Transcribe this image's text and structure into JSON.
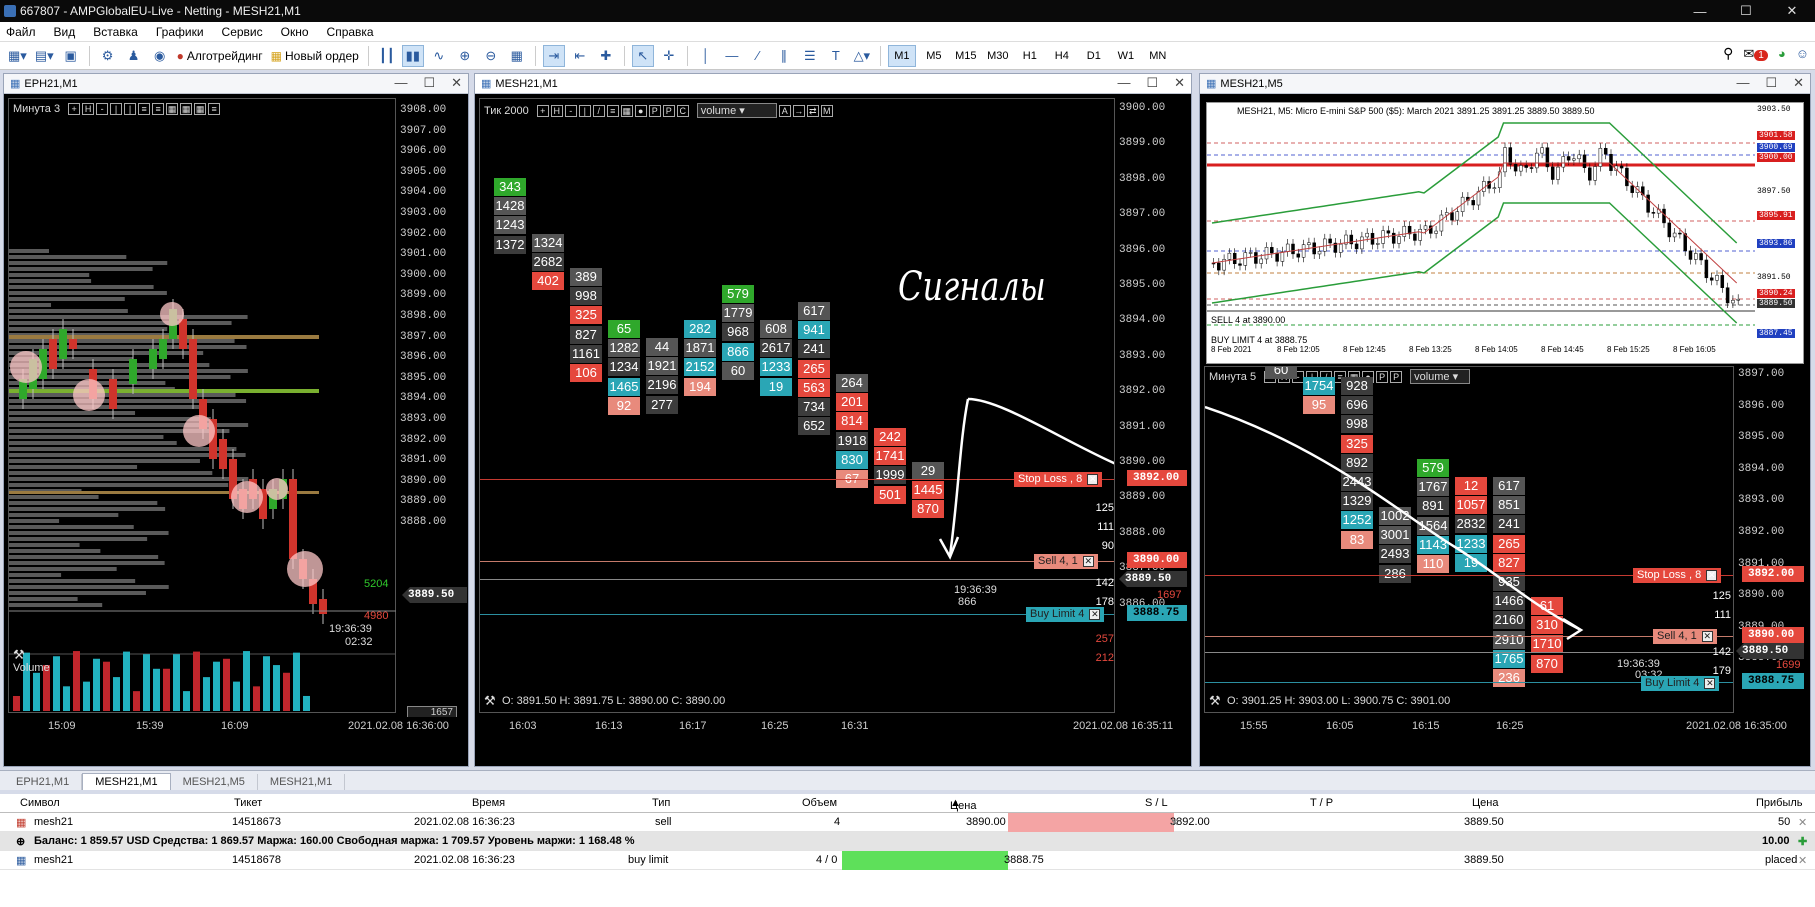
{
  "title": "667807 - AMPGlobalEU-Live - Netting - MESH21,M1",
  "menu": [
    "Файл",
    "Вид",
    "Вставка",
    "Графики",
    "Сервис",
    "Окно",
    "Справка"
  ],
  "toolbar": {
    "algo": "Алготрейдинг",
    "new_order": "Новый ордер",
    "timeframes": [
      "M1",
      "M5",
      "M15",
      "M30",
      "H1",
      "H4",
      "D1",
      "W1",
      "MN"
    ],
    "selected_tf": "M1",
    "notif": "1"
  },
  "w1": {
    "title": "EPH21,M1",
    "ctrl_label": "Минута  3",
    "prices": [
      "3908.00",
      "3907.00",
      "3906.00",
      "3905.00",
      "3904.00",
      "3903.00",
      "3902.00",
      "3901.00",
      "3900.00",
      "3899.00",
      "3898.00",
      "3897.00",
      "3896.00",
      "3895.00",
      "3894.00",
      "3893.00",
      "3892.00",
      "3891.00",
      "3890.00",
      "3889.00",
      "3888.00"
    ],
    "ask_vol": "5204",
    "bid_vol": "4980",
    "cur_price": "3889.50",
    "time": "19:36:39",
    "countdown": "02:32",
    "volume_label": "Volume",
    "volume_value": "1657",
    "times": [
      "15:09",
      "15:39",
      "16:09"
    ],
    "date": "2021.02.08 16:36:00"
  },
  "w2": {
    "title": "MESH21,M1",
    "ctrl_label": "Тик  2000",
    "select_value": "volume",
    "prices": [
      "3900.00",
      "3899.00",
      "3898.00",
      "3897.00",
      "3896.00",
      "3895.00",
      "3894.00",
      "3893.00",
      "3892.00",
      "3891.00",
      "3890.00",
      "3889.00",
      "3888.00",
      "3887.00",
      "3886.00"
    ],
    "sl_label": "Stop Loss , 8",
    "sl_price": "3892.00",
    "sell_label": "Sell  4, 1",
    "sell_price": "3890.00",
    "buy_label": "Buy Limit  4",
    "buy_price": "3888.75",
    "cur_price": "3889.50",
    "red_val": "1697",
    "time": "19:36:39",
    "tick": "866",
    "ohlc": "O: 3891.50   H: 3891.75   L: 3890.00   C: 3890.00",
    "times": [
      "16:03",
      "16:13",
      "16:17",
      "16:25",
      "16:31"
    ],
    "date": "2021.02.08 16:35:11",
    "side_vals": [
      "125",
      "111",
      "90",
      "142",
      "178",
      "257",
      "212"
    ],
    "signal": "Сигналы",
    "cells": [
      {
        "v": "343",
        "c": "c-grn"
      },
      {
        "v": "1428",
        "c": "c-gry"
      },
      {
        "v": "1243",
        "c": "c-gry"
      },
      {
        "v": "1372",
        "c": "c-dgy"
      },
      {
        "v": "1324",
        "c": "c-gry"
      },
      {
        "v": "2682",
        "c": "c-dgy"
      },
      {
        "v": "402",
        "c": "c-red"
      },
      {
        "v": "389",
        "c": "c-gry"
      },
      {
        "v": "998",
        "c": "c-dgy"
      },
      {
        "v": "325",
        "c": "c-red"
      },
      {
        "v": "827",
        "c": "c-dgy"
      },
      {
        "v": "1161",
        "c": "c-dgy"
      },
      {
        "v": "106",
        "c": "c-red"
      },
      {
        "v": "65",
        "c": "c-grn"
      },
      {
        "v": "1282",
        "c": "c-gry"
      },
      {
        "v": "1234",
        "c": "c-dgy"
      },
      {
        "v": "1465",
        "c": "c-cy"
      },
      {
        "v": "92",
        "c": "c-pink"
      },
      {
        "v": "44",
        "c": "c-gry"
      },
      {
        "v": "1921",
        "c": "c-gry"
      },
      {
        "v": "2196",
        "c": "c-dgy"
      },
      {
        "v": "277",
        "c": "c-dgy"
      },
      {
        "v": "282",
        "c": "c-cy"
      },
      {
        "v": "1871",
        "c": "c-gry"
      },
      {
        "v": "2152",
        "c": "c-cy"
      },
      {
        "v": "194",
        "c": "c-pink"
      },
      {
        "v": "579",
        "c": "c-grn"
      },
      {
        "v": "1779",
        "c": "c-gry"
      },
      {
        "v": "968",
        "c": "c-dgy"
      },
      {
        "v": "866",
        "c": "c-cy"
      },
      {
        "v": "60",
        "c": "c-gry"
      },
      {
        "v": "608",
        "c": "c-gry"
      },
      {
        "v": "2617",
        "c": "c-dgy"
      },
      {
        "v": "1233",
        "c": "c-cy"
      },
      {
        "v": "19",
        "c": "c-cy"
      },
      {
        "v": "617",
        "c": "c-gry"
      },
      {
        "v": "941",
        "c": "c-cy"
      },
      {
        "v": "241",
        "c": "c-dgy"
      },
      {
        "v": "265",
        "c": "c-red"
      },
      {
        "v": "563",
        "c": "c-red"
      },
      {
        "v": "734",
        "c": "c-dgy"
      },
      {
        "v": "652",
        "c": "c-dgy"
      },
      {
        "v": "264",
        "c": "c-gry"
      },
      {
        "v": "201",
        "c": "c-red"
      },
      {
        "v": "814",
        "c": "c-red"
      },
      {
        "v": "1918",
        "c": "c-dgy"
      },
      {
        "v": "830",
        "c": "c-cy"
      },
      {
        "v": "67",
        "c": "c-pink"
      },
      {
        "v": "242",
        "c": "c-red"
      },
      {
        "v": "1741",
        "c": "c-red"
      },
      {
        "v": "1999",
        "c": "c-dgy"
      },
      {
        "v": "501",
        "c": "c-red"
      },
      {
        "v": "29",
        "c": "c-gry"
      },
      {
        "v": "1445",
        "c": "c-red"
      },
      {
        "v": "870",
        "c": "c-red"
      }
    ]
  },
  "w3": {
    "title": "MESH21,M5",
    "mini_title": "MESH21, M5:  Micro E-mini S&P 500 ($5): March 2021  3891.25 3891.25 3889.50 3889.50",
    "mini_prices": [
      "3903.50",
      "3901.58",
      "3900.69",
      "3900.00",
      "3897.50",
      "3895.91",
      "3893.86",
      "3891.50",
      "3890.24",
      "3889.50",
      "3887.45"
    ],
    "mini_sell": "SELL 4 at 3890.00",
    "mini_buy": "BUY LIMIT 4 at 3888.75",
    "mini_times": [
      "8 Feb 2021",
      "8 Feb 12:05",
      "8 Feb 12:45",
      "8 Feb 13:25",
      "8 Feb 14:05",
      "8 Feb 14:45",
      "8 Feb 15:25",
      "8 Feb 16:05"
    ],
    "ctrl_label": "Минута  5",
    "select_value": "volume",
    "prices": [
      "3897.00",
      "3896.00",
      "3895.00",
      "3894.00",
      "3893.00",
      "3892.00",
      "3891.00",
      "3890.00",
      "3889.00",
      "3888.00"
    ],
    "sl_label": "Stop Loss , 8",
    "sl_price": "3892.00",
    "sell_label": "Sell  4, 1",
    "sell_price": "3890.00",
    "buy_label": "Buy Limit  4",
    "buy_price": "3888.75",
    "cur_price": "3889.50",
    "red_val": "1699",
    "time": "19:36:39",
    "countdown": "03:32",
    "ohlc": "O: 3901.25   H: 3903.00   L: 3900.75   C: 3901.00",
    "times": [
      "15:55",
      "16:05",
      "16:15",
      "16:25"
    ],
    "date": "2021.02.08 16:35:00",
    "side_vals": [
      "125",
      "111",
      "142",
      "179"
    ],
    "cells": [
      {
        "v": "60",
        "c": "c-gry"
      },
      {
        "v": "1754",
        "c": "c-cy"
      },
      {
        "v": "95",
        "c": "c-pink"
      },
      {
        "v": "928",
        "c": "c-dgy"
      },
      {
        "v": "696",
        "c": "c-dgy"
      },
      {
        "v": "998",
        "c": "c-dgy"
      },
      {
        "v": "325",
        "c": "c-red"
      },
      {
        "v": "892",
        "c": "c-dgy"
      },
      {
        "v": "2443",
        "c": "c-dgy"
      },
      {
        "v": "1329",
        "c": "c-dgy"
      },
      {
        "v": "1252",
        "c": "c-cy"
      },
      {
        "v": "83",
        "c": "c-pink"
      },
      {
        "v": "1002",
        "c": "c-gry"
      },
      {
        "v": "3001",
        "c": "c-gry"
      },
      {
        "v": "2493",
        "c": "c-dgy"
      },
      {
        "v": "286",
        "c": "c-dgy"
      },
      {
        "v": "579",
        "c": "c-grn"
      },
      {
        "v": "1767",
        "c": "c-gry"
      },
      {
        "v": "891",
        "c": "c-dgy"
      },
      {
        "v": "1564",
        "c": "c-gry"
      },
      {
        "v": "1143",
        "c": "c-cy"
      },
      {
        "v": "110",
        "c": "c-pink"
      },
      {
        "v": "12",
        "c": "c-red"
      },
      {
        "v": "1057",
        "c": "c-red"
      },
      {
        "v": "2832",
        "c": "c-dgy"
      },
      {
        "v": "1233",
        "c": "c-cy"
      },
      {
        "v": "19",
        "c": "c-cy"
      },
      {
        "v": "617",
        "c": "c-gry"
      },
      {
        "v": "851",
        "c": "c-gry"
      },
      {
        "v": "241",
        "c": "c-dgy"
      },
      {
        "v": "265",
        "c": "c-red"
      },
      {
        "v": "827",
        "c": "c-red"
      },
      {
        "v": "935",
        "c": "c-dgy"
      },
      {
        "v": "1466",
        "c": "c-dgy"
      },
      {
        "v": "2160",
        "c": "c-dgy"
      },
      {
        "v": "2910",
        "c": "c-gry"
      },
      {
        "v": "1765",
        "c": "c-cy"
      },
      {
        "v": "236",
        "c": "c-pink"
      },
      {
        "v": "61",
        "c": "c-red"
      },
      {
        "v": "310",
        "c": "c-red"
      },
      {
        "v": "1710",
        "c": "c-red"
      },
      {
        "v": "870",
        "c": "c-red"
      }
    ]
  },
  "tabs": [
    "EPH21,M1",
    "MESH21,M1",
    "MESH21,M5",
    "MESH21,M1"
  ],
  "active_tab": "MESH21,M1",
  "table": {
    "headers": [
      "Символ",
      "Тикет",
      "Время",
      "Тип",
      "Объем",
      "Цена",
      "S / L",
      "T / P",
      "Цена",
      "Прибыль"
    ],
    "rows": [
      {
        "sym": "mesh21",
        "ticket": "14518673",
        "time": "2021.02.08 16:36:23",
        "type": "sell",
        "vol": "4",
        "price": "3890.00",
        "sl": "3892.00",
        "tp": "",
        "cur": "3889.50",
        "profit": "50"
      },
      {
        "sym": "mesh21",
        "ticket": "14518678",
        "time": "2021.02.08 16:36:23",
        "type": "buy limit",
        "vol": "4 / 0",
        "price": "3888.75",
        "sl": "",
        "tp": "",
        "cur": "3889.50",
        "profit": "placed"
      }
    ],
    "balance": "Баланс: 1 859.57 USD  Средства: 1 869.57  Маржа: 160.00  Свободная маржа: 1 709.57  Уровень маржи: 1 168.48 %",
    "balance_profit": "10.00"
  }
}
